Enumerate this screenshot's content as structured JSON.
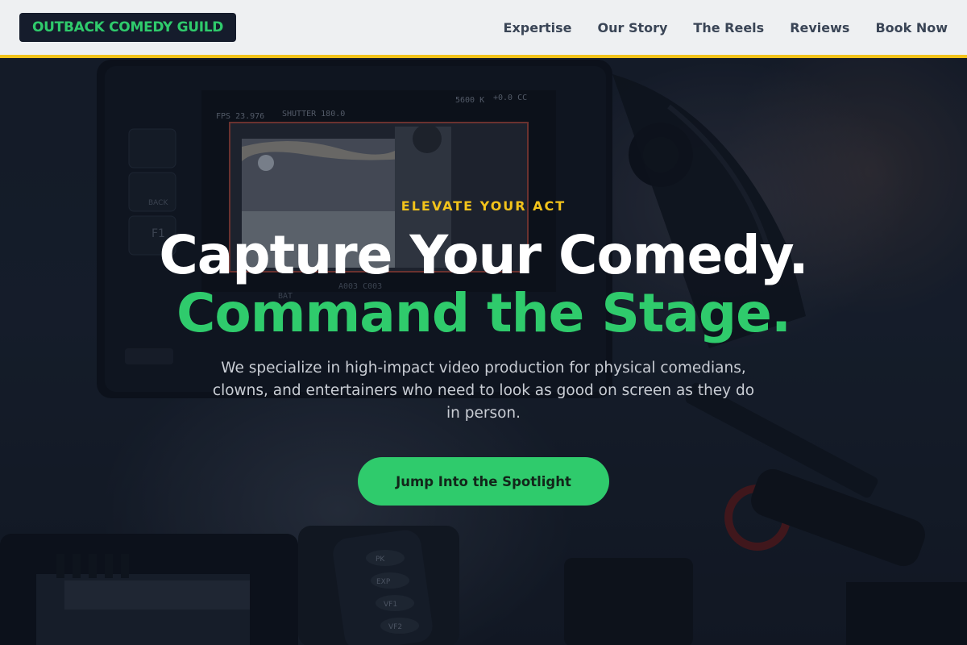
{
  "brand": {
    "logo_text": "OUTBACK COMEDY GUILD"
  },
  "nav": {
    "items": [
      {
        "label": "Expertise"
      },
      {
        "label": "Our Story"
      },
      {
        "label": "The Reels"
      },
      {
        "label": "Reviews"
      },
      {
        "label": "Book Now"
      }
    ]
  },
  "hero": {
    "eyebrow": "ELEVATE YOUR ACT",
    "headline_line1": "Capture Your Comedy.",
    "headline_line2": "Command the Stage.",
    "subtext": "We specialize in high-impact video production for physical comedians, clowns, and entertainers who need to look as good on screen as they do in person.",
    "cta_label": "Jump Into the Spotlight",
    "background_image": "camera-rig-photo",
    "monitor_readouts": {
      "fps": "FPS 23.976",
      "shutter": "SHUTTER 180.0",
      "wb": "5600 K",
      "ev": "+0.0 CC",
      "back_label": "BACK",
      "f1_label": "F1",
      "bat_label": "BAT",
      "card_label": "A003 C003",
      "cam_buttons": [
        "PK",
        "EXP",
        "VF1",
        "VF2"
      ]
    }
  },
  "colors": {
    "accent_green": "#2fcb6c",
    "accent_yellow": "#f2c31b",
    "nav_bg": "#eef0f2",
    "logo_bg": "#151c2c"
  }
}
